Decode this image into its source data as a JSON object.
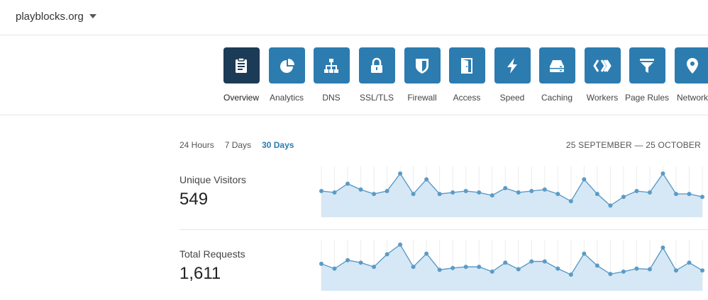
{
  "header": {
    "domain": "playblocks.org"
  },
  "apps": [
    {
      "label": "Overview",
      "icon": "clipboard-icon",
      "active": true
    },
    {
      "label": "Analytics",
      "icon": "pie-chart-icon",
      "active": false
    },
    {
      "label": "DNS",
      "icon": "network-tree-icon",
      "active": false
    },
    {
      "label": "SSL/TLS",
      "icon": "lock-icon",
      "active": false
    },
    {
      "label": "Firewall",
      "icon": "shield-icon",
      "active": false
    },
    {
      "label": "Access",
      "icon": "door-icon",
      "active": false
    },
    {
      "label": "Speed",
      "icon": "lightning-icon",
      "active": false
    },
    {
      "label": "Caching",
      "icon": "server-icon",
      "active": false
    },
    {
      "label": "Workers",
      "icon": "workers-icon",
      "active": false
    },
    {
      "label": "Page Rules",
      "icon": "funnel-icon",
      "active": false
    },
    {
      "label": "Network",
      "icon": "location-pin-icon",
      "active": false
    }
  ],
  "range": {
    "tabs": [
      "24 Hours",
      "7 Days",
      "30 Days"
    ],
    "selected": "30 Days",
    "date_range": "25 SEPTEMBER — 25 OCTOBER"
  },
  "metrics": {
    "unique_visitors": {
      "label": "Unique Visitors",
      "value": "549"
    },
    "total_requests": {
      "label": "Total Requests",
      "value": "1,611"
    }
  },
  "colors": {
    "tile": "#2c7cb0",
    "tile_active": "#1c3b57",
    "line": "#5b9bc6",
    "fill": "#d6e8f5",
    "accent": "#2c7cb0"
  },
  "chart_data": [
    {
      "type": "area",
      "series": [
        {
          "name": "Unique Visitors",
          "values": [
            18,
            17,
            23,
            19,
            16,
            18,
            30,
            16,
            26,
            16,
            17,
            18,
            17,
            15,
            20,
            17,
            18,
            19,
            16,
            11,
            26,
            16,
            8,
            14,
            18,
            17,
            30,
            16,
            16,
            14
          ]
        }
      ],
      "ylim": [
        0,
        35
      ]
    },
    {
      "type": "area",
      "series": [
        {
          "name": "Total Requests",
          "values": [
            45,
            37,
            51,
            47,
            40,
            61,
            77,
            40,
            62,
            35,
            38,
            40,
            40,
            32,
            47,
            36,
            49,
            49,
            37,
            27,
            62,
            42,
            28,
            32,
            37,
            36,
            72,
            34,
            47,
            34
          ]
        }
      ],
      "ylim": [
        0,
        85
      ]
    }
  ]
}
